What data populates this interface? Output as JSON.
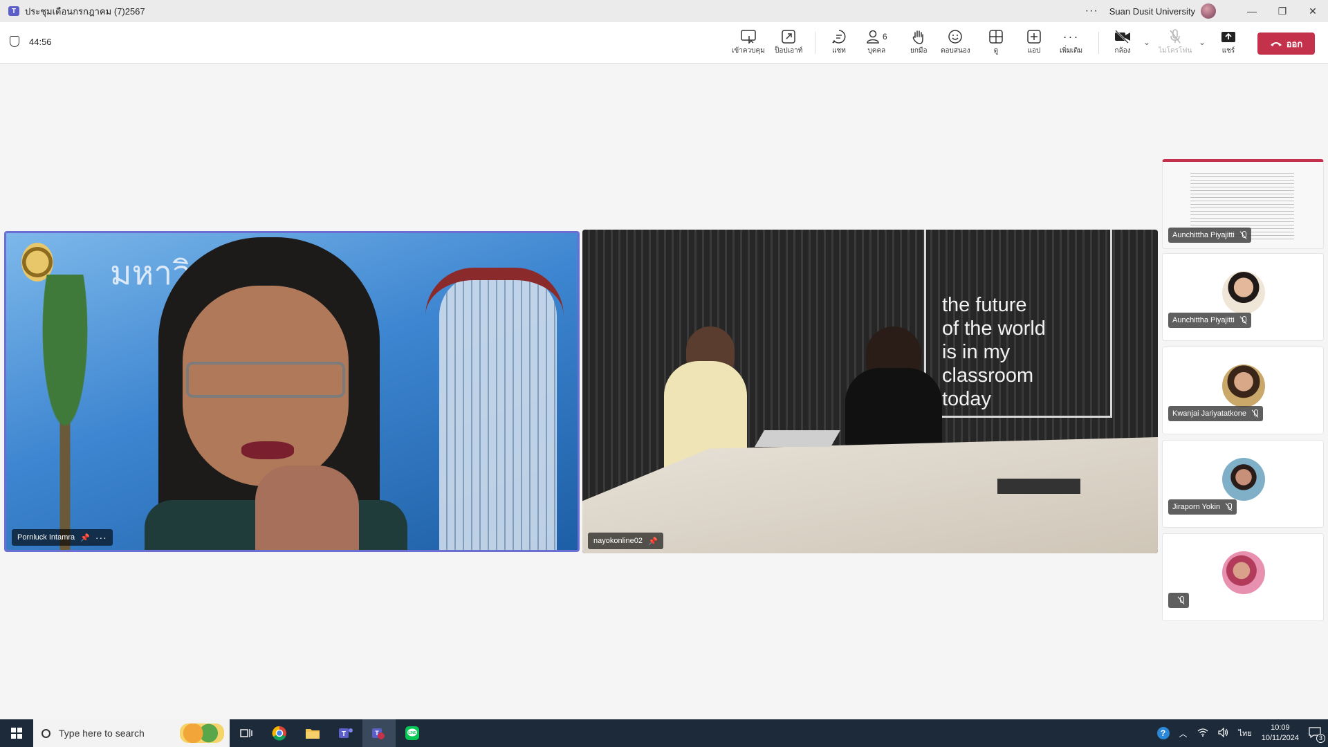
{
  "titlebar": {
    "title": "ประชุมเดือนกรกฎาคม (7)2567",
    "more": "···",
    "org": "Suan Dusit University"
  },
  "toolbar": {
    "timer": "44:56",
    "buttons": {
      "control": "เข้าควบคุม",
      "popout": "ป็อปเอาท์",
      "chat": "แชท",
      "people": "บุคคล",
      "people_count": "6",
      "raise": "ยกมือ",
      "react": "ตอบสนอง",
      "view": "ดู",
      "apps": "แอป",
      "more": "เพิ่มเติม",
      "camera": "กล้อง",
      "mic": "ไมโครโฟน",
      "share": "แชร์",
      "leave": "ออก"
    }
  },
  "stage": {
    "tile1": {
      "name": "Pornluck Intamra",
      "banner": "มหาวิ      นดุสิต"
    },
    "tile2": {
      "name": "nayokonline02",
      "quote": [
        "the future",
        "of the world",
        "is in my",
        "classroom",
        "today"
      ]
    }
  },
  "side": {
    "screenshare_name": "Aunchittha Piyajitti",
    "participants": [
      {
        "name": "Aunchittha Piyajitti"
      },
      {
        "name": "Kwanjai Jariyatatkone"
      },
      {
        "name": "Jiraporn Yokin"
      },
      {
        "name": ""
      }
    ]
  },
  "taskbar": {
    "search_placeholder": "Type here to search",
    "lang": "ไทย",
    "time": "10:09",
    "date": "10/11/2024",
    "notif_count": "3"
  }
}
